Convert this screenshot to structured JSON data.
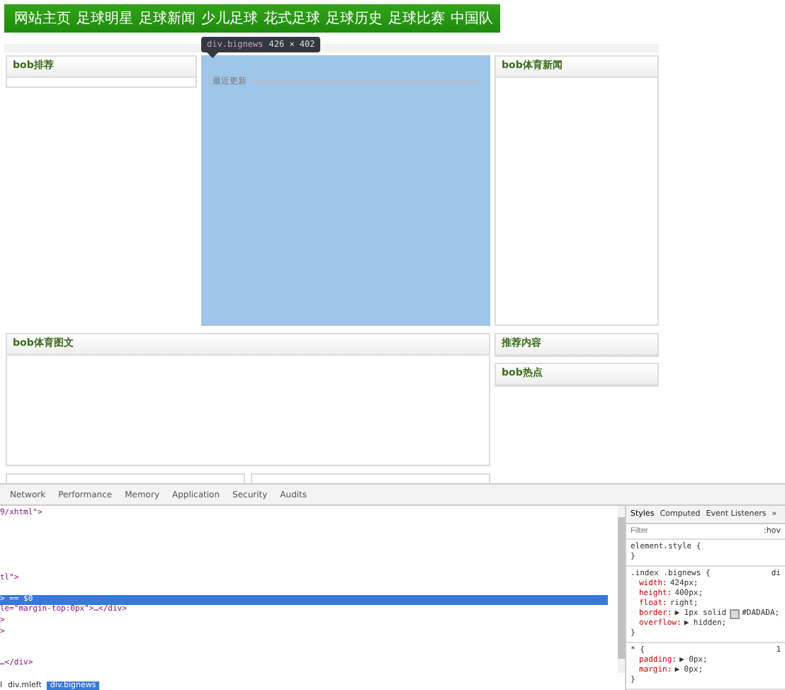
{
  "nav": {
    "items": [
      "网站主页",
      "足球明星",
      "足球新闻",
      "少儿足球",
      "花式足球",
      "足球历史",
      "足球比赛",
      "中国队"
    ]
  },
  "inspector_tooltip": {
    "selector": "div.bignews",
    "size": "426 × 402"
  },
  "left_panels": [
    {
      "title": "bob排荐"
    }
  ],
  "main": {
    "section_title": "最近更新"
  },
  "right_panels": [
    {
      "title": "bob体育新闻"
    }
  ],
  "wide_panel": {
    "title": "bob体育图文"
  },
  "right_lower_panels": [
    {
      "title": "推荐内容"
    },
    {
      "title": "bob热点"
    }
  ],
  "devtools": {
    "tabs": [
      {
        "label": "Network",
        "selected": false
      },
      {
        "label": "Performance",
        "selected": false
      },
      {
        "label": "Memory",
        "selected": false
      },
      {
        "label": "Application",
        "selected": false
      },
      {
        "label": "Security",
        "selected": false
      },
      {
        "label": "Audits",
        "selected": false
      }
    ],
    "code_lines": [
      {
        "kind": "code",
        "text": "9/xhtml\">",
        "selected": false
      },
      {
        "kind": "blank"
      },
      {
        "kind": "blank"
      },
      {
        "kind": "blank"
      },
      {
        "kind": "blank"
      },
      {
        "kind": "blank"
      },
      {
        "kind": "code",
        "text": "tl\">",
        "selected": false
      },
      {
        "kind": "blank"
      },
      {
        "kind": "code",
        "text": "> == $0",
        "selected": true
      },
      {
        "kind": "code",
        "text": "le=\"margin-top:0px\">…</div>",
        "selected": false
      },
      {
        "kind": "code",
        "text": ">",
        "selected": false
      },
      {
        "kind": "code",
        "text": ">",
        "selected": false
      },
      {
        "kind": "blank"
      },
      {
        "kind": "blank"
      },
      {
        "kind": "code",
        "text": "…</div>",
        "selected": false
      }
    ],
    "breadcrumbs": [
      {
        "label": "l",
        "selected": false
      },
      {
        "label": "div.mleft",
        "selected": false
      },
      {
        "label": "div.bignews",
        "selected": true
      }
    ],
    "style_tabs": [
      {
        "label": "Styles",
        "selected": true
      },
      {
        "label": "Computed",
        "selected": false
      },
      {
        "label": "Event Listeners",
        "selected": false
      },
      {
        "label": "»",
        "selected": false
      }
    ],
    "filter": {
      "placeholder": "Filter"
    },
    "hov": ":hov",
    "rules": [
      {
        "selector": "element.style {",
        "close": "}"
      },
      {
        "selector": ".index .bignews {",
        "source": "di",
        "declarations": [
          {
            "name": "width:",
            "value": "424px;"
          },
          {
            "name": "height:",
            "value": "400px;"
          },
          {
            "name": "float:",
            "value": "right;"
          },
          {
            "name": "border:",
            "value": "▶ 1px solid",
            "color": "#dadada",
            "value2": "#DADADA;"
          },
          {
            "name": "overflow:",
            "value": "▶ hidden;"
          }
        ],
        "close": "}"
      },
      {
        "selector": "* {",
        "source": "1",
        "declarations": [
          {
            "name": "padding:",
            "value": "▶ 0px;"
          },
          {
            "name": "margin:",
            "value": "▶ 0px;"
          }
        ],
        "close": "}"
      }
    ]
  }
}
